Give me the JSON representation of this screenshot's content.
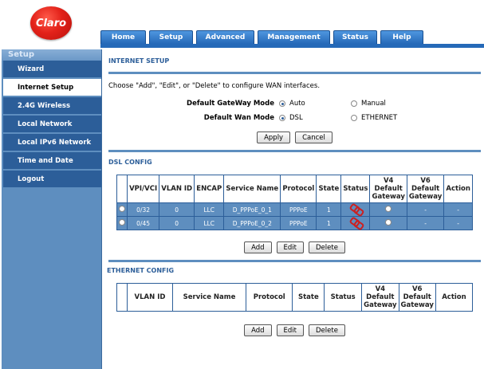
{
  "logo": {
    "text": "Claro"
  },
  "nav": {
    "tabs": [
      "Home",
      "Setup",
      "Advanced",
      "Management",
      "Status",
      "Help"
    ]
  },
  "sidebar": {
    "title": "Setup",
    "items": [
      "Wizard",
      "Internet Setup",
      "2.4G Wireless",
      "Local Network",
      "Local IPv6 Network",
      "Time and Date",
      "Logout"
    ],
    "active": "Internet Setup"
  },
  "internet": {
    "title": "INTERNET SETUP",
    "desc": "Choose \"Add\", \"Edit\", or \"Delete\" to configure WAN interfaces.",
    "gateway_label": "Default GateWay Mode",
    "gateway_opts": [
      "Auto",
      "Manual"
    ],
    "gateway_selected": "Auto",
    "wan_label": "Default Wan Mode",
    "wan_opts": [
      "DSL",
      "ETHERNET"
    ],
    "wan_selected": "DSL",
    "apply": "Apply",
    "cancel": "Cancel"
  },
  "dsl": {
    "title": "DSL CONFIG",
    "headers": [
      "VPI/VCI",
      "VLAN ID",
      "ENCAP",
      "Service Name",
      "Protocol",
      "State",
      "Status",
      "V4 Default Gateway",
      "V6 Default Gateway",
      "Action"
    ],
    "rows": [
      [
        "0/32",
        "0",
        "LLC",
        "D_PPPoE_0_1",
        "PPPoE",
        "1",
        "",
        "",
        "-",
        "-"
      ],
      [
        "0/45",
        "0",
        "LLC",
        "D_PPPoE_0_2",
        "PPPoE",
        "1",
        "",
        "",
        "-",
        "-"
      ]
    ],
    "add": "Add",
    "edit": "Edit",
    "delete": "Delete"
  },
  "eth": {
    "title": "ETHERNET CONFIG",
    "headers": [
      "VLAN ID",
      "Service Name",
      "Protocol",
      "State",
      "Status",
      "V4 Default Gateway",
      "V6 Default Gateway",
      "Action"
    ],
    "add": "Add",
    "edit": "Edit",
    "delete": "Delete"
  },
  "colors": {
    "accent": "#2c5e99",
    "sidebar": "#5e8ebf",
    "tab": "#2569b8",
    "brand": "#e3221a"
  }
}
